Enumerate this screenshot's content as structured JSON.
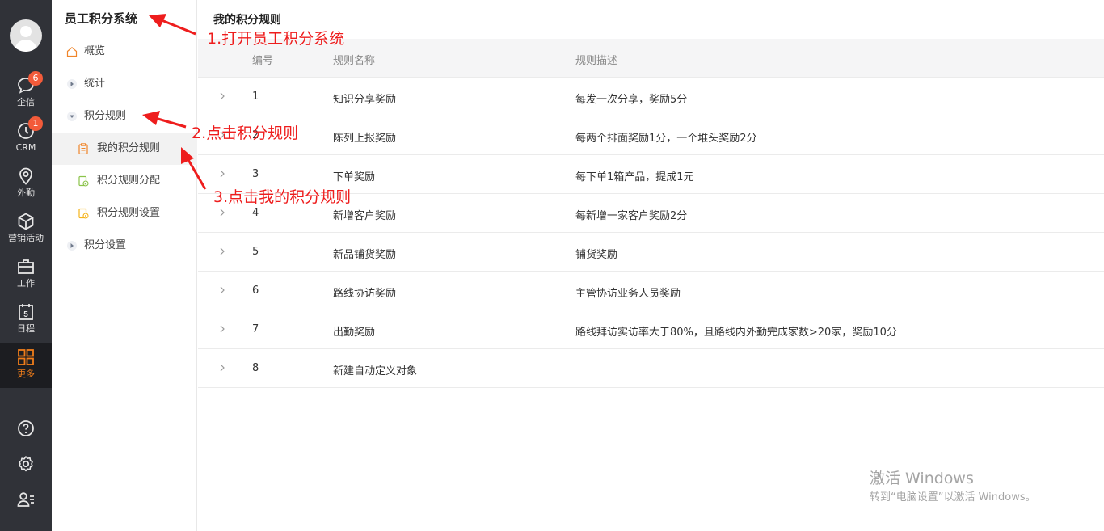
{
  "rail": {
    "items": [
      {
        "label": "企信",
        "icon": "chat-icon",
        "badge": "6"
      },
      {
        "label": "CRM",
        "icon": "clock-icon",
        "badge": "1"
      },
      {
        "label": "外勤",
        "icon": "location-pin-icon"
      },
      {
        "label": "营销活动",
        "icon": "cube-icon"
      },
      {
        "label": "工作",
        "icon": "briefcase-icon"
      },
      {
        "label": "日程",
        "icon": "calendar-icon",
        "day": "5"
      },
      {
        "label": "更多",
        "icon": "grid-icon",
        "active": true
      }
    ],
    "bottom_icons": [
      "help-icon",
      "settings-icon",
      "user-list-icon"
    ],
    "active_color": "#f07d1a",
    "badge_color": "#f35b3a"
  },
  "menu": {
    "title": "员工积分系统",
    "items": [
      {
        "label": "概览",
        "icon": "home-icon"
      },
      {
        "label": "统计",
        "icon": "caret-right-icon"
      },
      {
        "label": "积分规则",
        "icon": "caret-down-icon",
        "expanded": true
      },
      {
        "label": "我的积分规则",
        "icon": "clipboard-icon",
        "selected": true
      },
      {
        "label": "积分规则分配",
        "icon": "assign-doc-icon"
      },
      {
        "label": "积分规则设置",
        "icon": "settings-doc-icon"
      },
      {
        "label": "积分设置",
        "icon": "caret-right-icon"
      }
    ]
  },
  "main": {
    "title": "我的积分规则",
    "columns": [
      "编号",
      "规则名称",
      "规则描述"
    ],
    "rows": [
      {
        "id": "1",
        "name": "知识分享奖励",
        "desc": "每发一次分享，奖励5分"
      },
      {
        "id": "2",
        "name": "陈列上报奖励",
        "desc": "每两个排面奖励1分，一个堆头奖励2分"
      },
      {
        "id": "3",
        "name": "下单奖励",
        "desc": "每下单1箱产品，提成1元"
      },
      {
        "id": "4",
        "name": "新增客户奖励",
        "desc": "每新增一家客户奖励2分"
      },
      {
        "id": "5",
        "name": "新品铺货奖励",
        "desc": "铺货奖励"
      },
      {
        "id": "6",
        "name": "路线协访奖励",
        "desc": "主管协访业务人员奖励"
      },
      {
        "id": "7",
        "name": "出勤奖励",
        "desc": "路线拜访实访率大于80%，且路线内外勤完成家数>20家，奖励10分"
      },
      {
        "id": "8",
        "name": "新建自动定义对象",
        "desc": ""
      }
    ]
  },
  "annotations": {
    "step1": "1.打开员工积分系统",
    "step2": "2.点击积分规则",
    "step3": "3.点击我的积分规则",
    "color": "#ee1d1d"
  },
  "watermark": {
    "line1": "激活 Windows",
    "line2": "转到“电脑设置”以激活 Windows。"
  }
}
